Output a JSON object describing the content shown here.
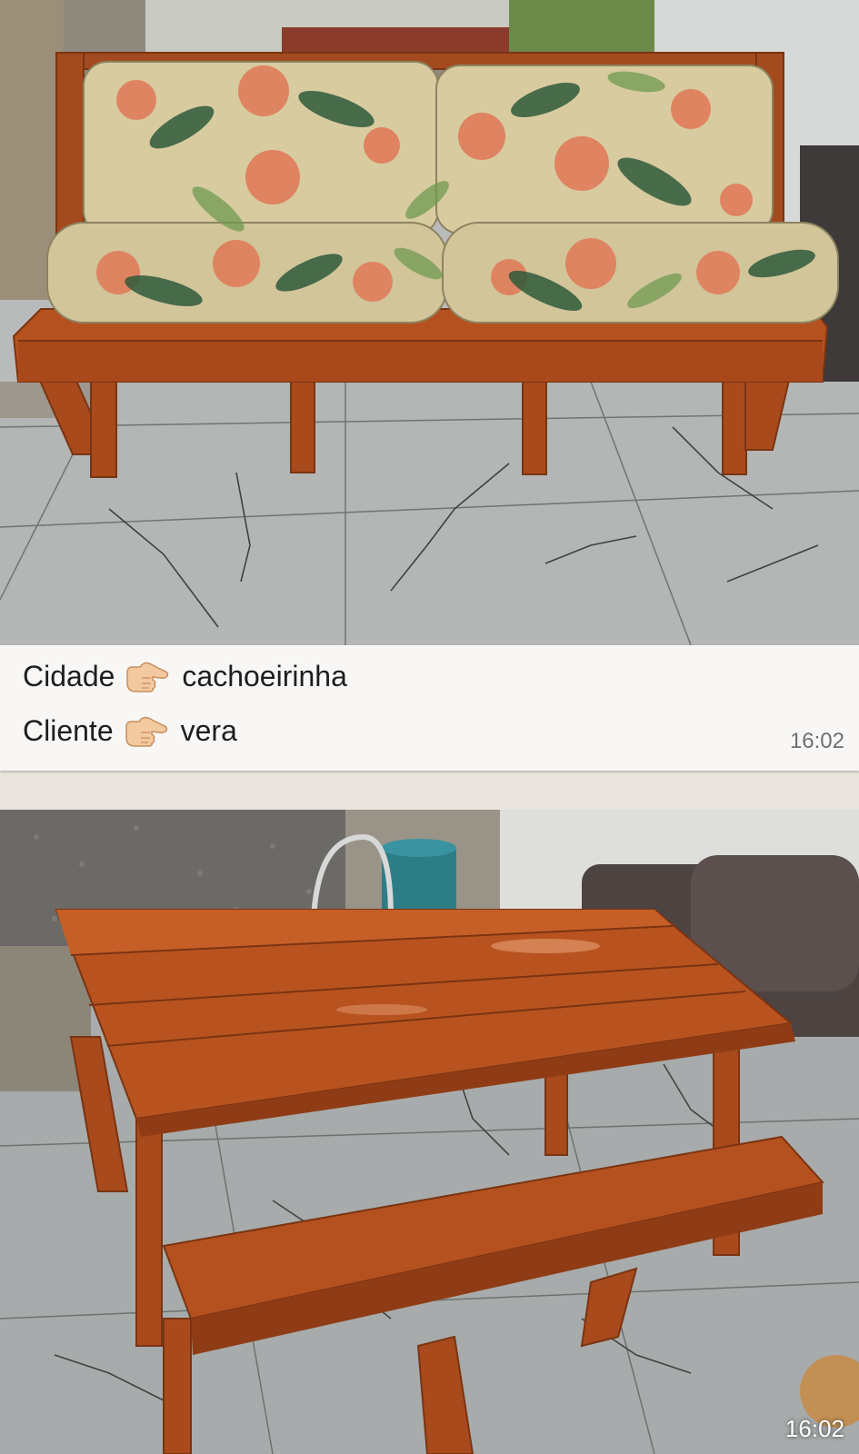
{
  "message_1": {
    "photo_time": ""
  },
  "message_2": {
    "line1_label": "Cidade",
    "line1_emoji": "pointing-right-hand-icon",
    "line1_value": "cachoeirinha",
    "line2_label": "Cliente",
    "line2_emoji": "pointing-right-hand-icon",
    "line2_value": "vera",
    "time": "16:02"
  },
  "message_3": {
    "photo_time": "16:02"
  },
  "colors": {
    "bubble_background": "#f8f7f5",
    "chat_background": "#e9e4dd",
    "wood": "#b5511f",
    "timestamp": "#707070"
  }
}
